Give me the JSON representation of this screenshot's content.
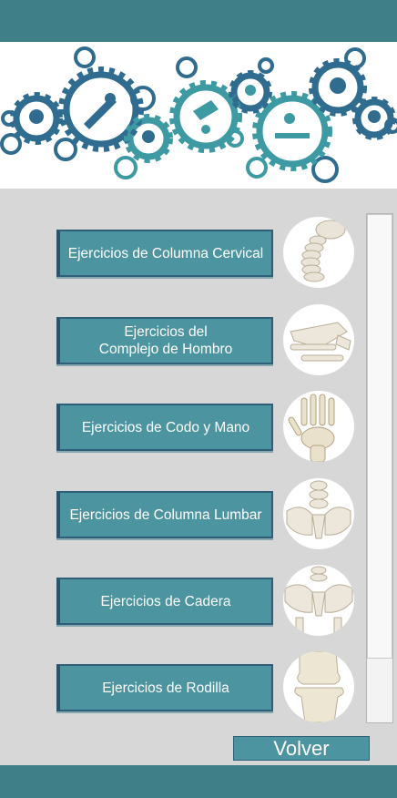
{
  "colors": {
    "bar": "#3e7f88",
    "button": "#4c94a0",
    "button_border": "#2f5e78",
    "background": "#d7d7d7",
    "banner_blue": "#2f6c8f",
    "banner_teal": "#3d9aa3"
  },
  "banner": {
    "icons": [
      "pelvis-icon",
      "massage-icon",
      "wheelchair-icon",
      "knee-icon",
      "therapy-table-icon",
      "foot-icon",
      "walker-icon",
      "exercise-icon"
    ]
  },
  "exercises": [
    {
      "label": "Ejercicios de Columna Cervical",
      "thumb": "cervical-spine-icon"
    },
    {
      "label": "Ejercicios del\nComplejo de Hombro",
      "thumb": "shoulder-icon"
    },
    {
      "label": "Ejercicios de Codo y Mano",
      "thumb": "hand-icon"
    },
    {
      "label": "Ejercicios de Columna Lumbar",
      "thumb": "lumbar-spine-icon"
    },
    {
      "label": "Ejercicios de Cadera",
      "thumb": "hip-icon"
    },
    {
      "label": "Ejercicios de Rodilla",
      "thumb": "knee-bone-icon"
    }
  ],
  "footer": {
    "back_label": "Volver"
  }
}
